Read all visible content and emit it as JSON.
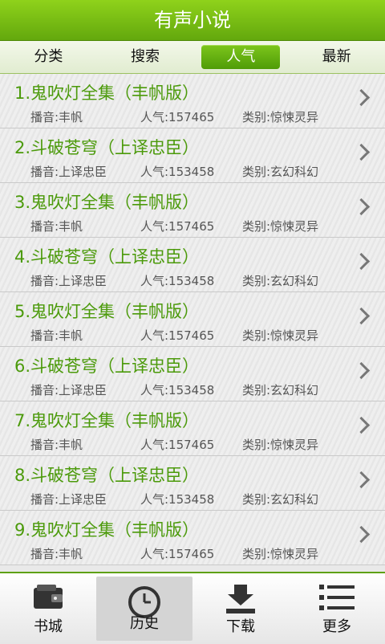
{
  "app": {
    "title": "有声小说"
  },
  "tabs": [
    {
      "label": "分类"
    },
    {
      "label": "搜索"
    },
    {
      "label": "人气"
    },
    {
      "label": "最新"
    }
  ],
  "list": [
    {
      "title": "1.鬼吹灯全集（丰帆版）",
      "narrator": "播音:丰帆",
      "popularity": "人气:157465",
      "category": "类别:惊悚灵异"
    },
    {
      "title": "2.斗破苍穹（上译忠臣）",
      "narrator": "播音:上译忠臣",
      "popularity": "人气:153458",
      "category": "类别:玄幻科幻"
    },
    {
      "title": "3.鬼吹灯全集（丰帆版）",
      "narrator": "播音:丰帆",
      "popularity": "人气:157465",
      "category": "类别:惊悚灵异"
    },
    {
      "title": "4.斗破苍穹（上译忠臣）",
      "narrator": "播音:上译忠臣",
      "popularity": "人气:153458",
      "category": "类别:玄幻科幻"
    },
    {
      "title": "5.鬼吹灯全集（丰帆版）",
      "narrator": "播音:丰帆",
      "popularity": "人气:157465",
      "category": "类别:惊悚灵异"
    },
    {
      "title": "6.斗破苍穹（上译忠臣）",
      "narrator": "播音:上译忠臣",
      "popularity": "人气:153458",
      "category": "类别:玄幻科幻"
    },
    {
      "title": "7.鬼吹灯全集（丰帆版）",
      "narrator": "播音:丰帆",
      "popularity": "人气:157465",
      "category": "类别:惊悚灵异"
    },
    {
      "title": "8.斗破苍穹（上译忠臣）",
      "narrator": "播音:上译忠臣",
      "popularity": "人气:153458",
      "category": "类别:玄幻科幻"
    },
    {
      "title": "9.鬼吹灯全集（丰帆版）",
      "narrator": "播音:丰帆",
      "popularity": "人气:157465",
      "category": "类别:惊悚灵异"
    }
  ],
  "bottom_nav": [
    {
      "label": "书城",
      "icon": "wallet-icon"
    },
    {
      "label": "历史",
      "icon": "clock-icon"
    },
    {
      "label": "下载",
      "icon": "download-icon"
    },
    {
      "label": "更多",
      "icon": "list-icon"
    }
  ],
  "colors": {
    "accent": "#63a80d",
    "title_text": "#4b9a0a"
  }
}
